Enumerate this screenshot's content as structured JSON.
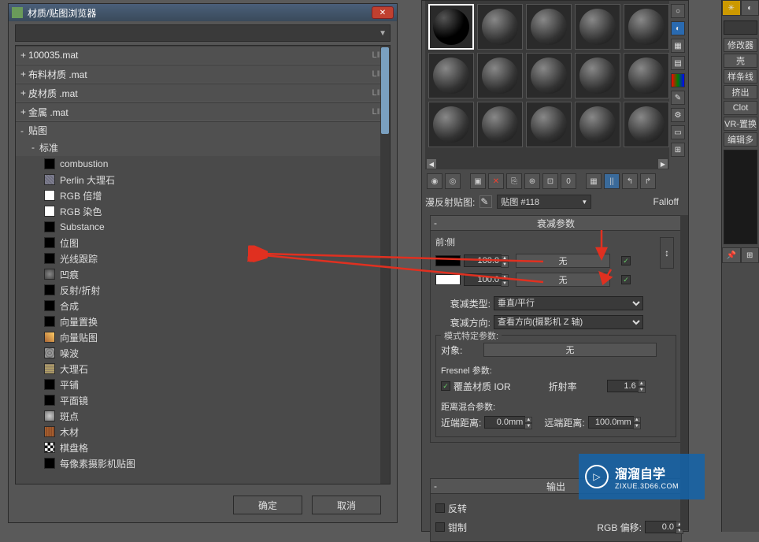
{
  "dialog": {
    "title": "材质/贴图浏览器",
    "search_placeholder": "",
    "libs": [
      {
        "prefix": "+",
        "name": "100035.mat",
        "tag": "LIB"
      },
      {
        "prefix": "+",
        "name": "布料材质 .mat",
        "tag": "LIB"
      },
      {
        "prefix": "+",
        "name": "皮材质 .mat",
        "tag": "LIB"
      },
      {
        "prefix": "+",
        "name": "金属 .mat",
        "tag": "LIB"
      }
    ],
    "category": {
      "prefix": "-",
      "name": "贴图"
    },
    "subcategory": {
      "prefix": "-",
      "name": "标准"
    },
    "maps": [
      {
        "name": "combustion",
        "swatch": "#000"
      },
      {
        "name": "Perlin 大理石",
        "swatch": "#778"
      },
      {
        "name": "RGB 倍增",
        "swatch": "#fff"
      },
      {
        "name": "RGB 染色",
        "swatch": "#fff"
      },
      {
        "name": "Substance",
        "swatch": "#000"
      },
      {
        "name": "位图",
        "swatch": "#000"
      },
      {
        "name": "光线跟踪",
        "swatch": "#000"
      },
      {
        "name": "凹痕",
        "swatch": "#666"
      },
      {
        "name": "反射/折射",
        "swatch": "#000"
      },
      {
        "name": "合成",
        "swatch": "#000"
      },
      {
        "name": "向量置换",
        "swatch": "#000"
      },
      {
        "name": "向量贴图",
        "swatch": "#a63"
      },
      {
        "name": "噪波",
        "swatch": "#999"
      },
      {
        "name": "大理石",
        "swatch": "#ba6"
      },
      {
        "name": "平铺",
        "swatch": "#000"
      },
      {
        "name": "平面镜",
        "swatch": "#000"
      },
      {
        "name": "斑点",
        "swatch": "#aaa"
      },
      {
        "name": "木材",
        "swatch": "#a63"
      },
      {
        "name": "棋盘格",
        "swatch": "#000"
      },
      {
        "name": "每像素摄影机贴图",
        "swatch": "#000"
      }
    ],
    "ok": "确定",
    "cancel": "取消"
  },
  "editor": {
    "diffuse_label": "漫反射贴图:",
    "map_name": "贴图 #118",
    "falloff_label": "Falloff",
    "rollup1_title": "衰减参数",
    "front_side": "前:侧",
    "slot1": {
      "value": "100.0",
      "none": "无",
      "color": "#000"
    },
    "slot2": {
      "value": "100.0",
      "none": "无",
      "color": "#fff"
    },
    "falloff_type_label": "衰减类型:",
    "falloff_type": "垂直/平行",
    "falloff_dir_label": "衰减方向:",
    "falloff_dir": "查看方向(摄影机 Z 轴)",
    "mode_group": "模式特定参数:",
    "object_label": "对象:",
    "object_value": "无",
    "fresnel_group": "Fresnel 参数:",
    "override_ior": "覆盖材质 IOR",
    "ior_label": "折射率",
    "ior_value": "1.6",
    "distance_group": "距离混合参数:",
    "near_label": "近端距离:",
    "near_value": "0.0mm",
    "far_label": "远端距离:",
    "far_value": "100.0mm",
    "rollup2_title": "输出",
    "invert": "反转",
    "clamp": "钳制",
    "rgb_offset_label": "RGB 偏移:",
    "rgb_offset_value": "0.0"
  },
  "modpanel": {
    "title": "修改器",
    "items": [
      "壳",
      "样条线",
      "挤出",
      "Clot",
      "VR-置换",
      "编辑多"
    ]
  },
  "watermark": {
    "brand": "溜溜自学",
    "url": "ZIXUE.3D66.COM"
  },
  "icons": {
    "close": "✕",
    "caret_down": "▼",
    "caret_up": "▲",
    "caret_left": "◀",
    "caret_right": "▶",
    "check": "✓",
    "play": "▷",
    "swap": "↕",
    "dropper": "✎",
    "delete": "✕"
  }
}
